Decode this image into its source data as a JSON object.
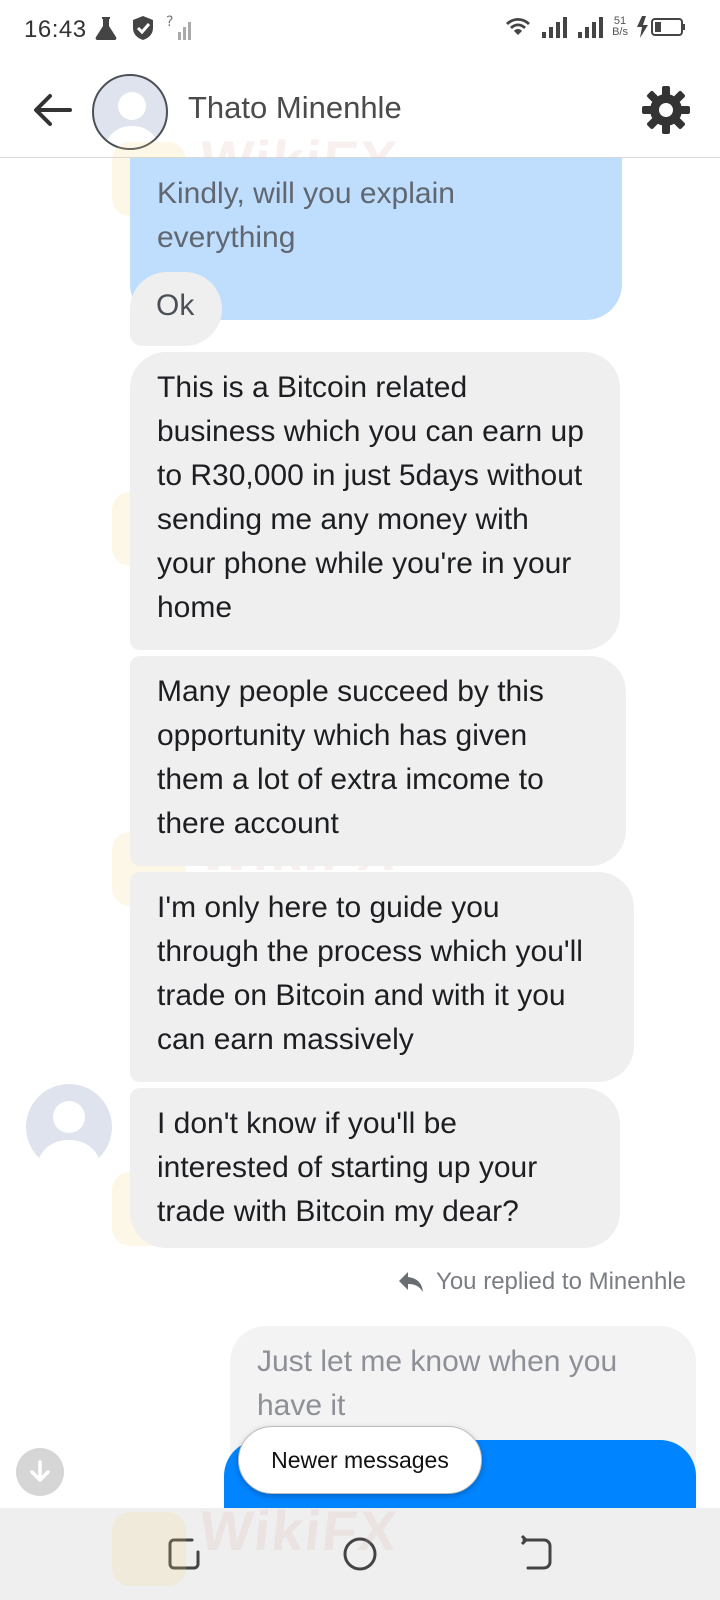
{
  "status_bar": {
    "time": "16:43",
    "speed_top": "51",
    "speed_bottom": "B/s"
  },
  "header": {
    "contact_name": "Thato Minenhle"
  },
  "messages": [
    {
      "id": "kindly",
      "text": "Kindly, will you explain everything"
    },
    {
      "id": "ok",
      "text": "Ok"
    },
    {
      "id": "msg1",
      "text": "This is a Bitcoin related business which you can earn up to R30,000 in just 5days without sending me any money with your phone while you're in your home"
    },
    {
      "id": "msg2",
      "text": "Many people succeed by this opportunity which has given them a lot of extra imcome to there account"
    },
    {
      "id": "msg3",
      "text": "I'm only here to guide you through the process which you'll trade on Bitcoin and with it you can earn massively"
    },
    {
      "id": "msg4",
      "text": "I don't know if you'll be interested of starting up your trade with Bitcoin my dear?"
    }
  ],
  "reply_indicator": "You replied to Minenhle",
  "reply_message": "Just let me know when you have it",
  "newer_messages_label": "Newer messages",
  "watermark_text": "WikiFX",
  "colors": {
    "outgoing_bubble": "#0084ff",
    "outgoing_bubble_light": "#bfdefd",
    "incoming_bubble": "#efefef"
  }
}
